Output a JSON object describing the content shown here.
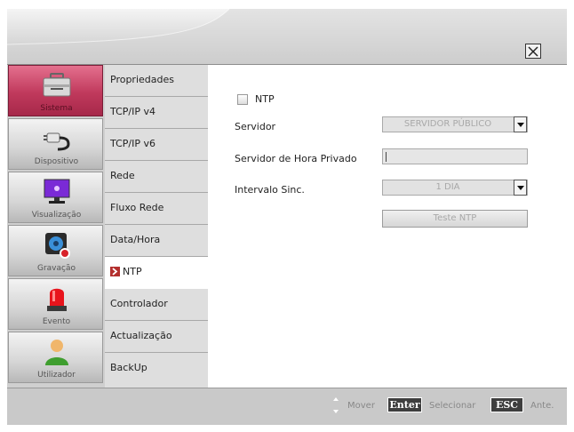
{
  "window": {
    "close_icon": "close-x-icon"
  },
  "categories": [
    {
      "label": "Sistema",
      "icon": "toolbox-icon",
      "active": true
    },
    {
      "label": "Dispositivo",
      "icon": "plug-icon",
      "active": false
    },
    {
      "label": "Visualização",
      "icon": "monitor-icon",
      "active": false
    },
    {
      "label": "Gravação",
      "icon": "camera-record-icon",
      "active": false
    },
    {
      "label": "Evento",
      "icon": "alarm-light-icon",
      "active": false
    },
    {
      "label": "Utilizador",
      "icon": "user-icon",
      "active": false
    }
  ],
  "menu": {
    "items": [
      {
        "label": "Propriedades"
      },
      {
        "label": "TCP/IP v4"
      },
      {
        "label": "TCP/IP v6"
      },
      {
        "label": "Rede"
      },
      {
        "label": "Fluxo Rede"
      },
      {
        "label": "Data/Hora"
      },
      {
        "label": "NTP"
      },
      {
        "label": "Controlador"
      },
      {
        "label": "Actualização"
      },
      {
        "label": "BackUp"
      }
    ],
    "active_index": 6
  },
  "ntp": {
    "enable_label": "NTP",
    "enabled": false,
    "server_label": "Servidor",
    "server_value": "SERVIDOR PÚBLICO",
    "private_label": "Servidor de Hora Privado",
    "private_value": "",
    "interval_label": "Intervalo Sinc.",
    "interval_value": "1 DIA",
    "test_button": "Teste NTP"
  },
  "footer": {
    "move_label": "Mover",
    "enter_key": "Enter",
    "select_label": "Selecionar",
    "esc_key": "ESC",
    "back_label": "Ante."
  },
  "colors": {
    "active_category": "#c0395c",
    "menu_arrow": "#b3302e",
    "disabled_text": "#a8a8a8"
  }
}
